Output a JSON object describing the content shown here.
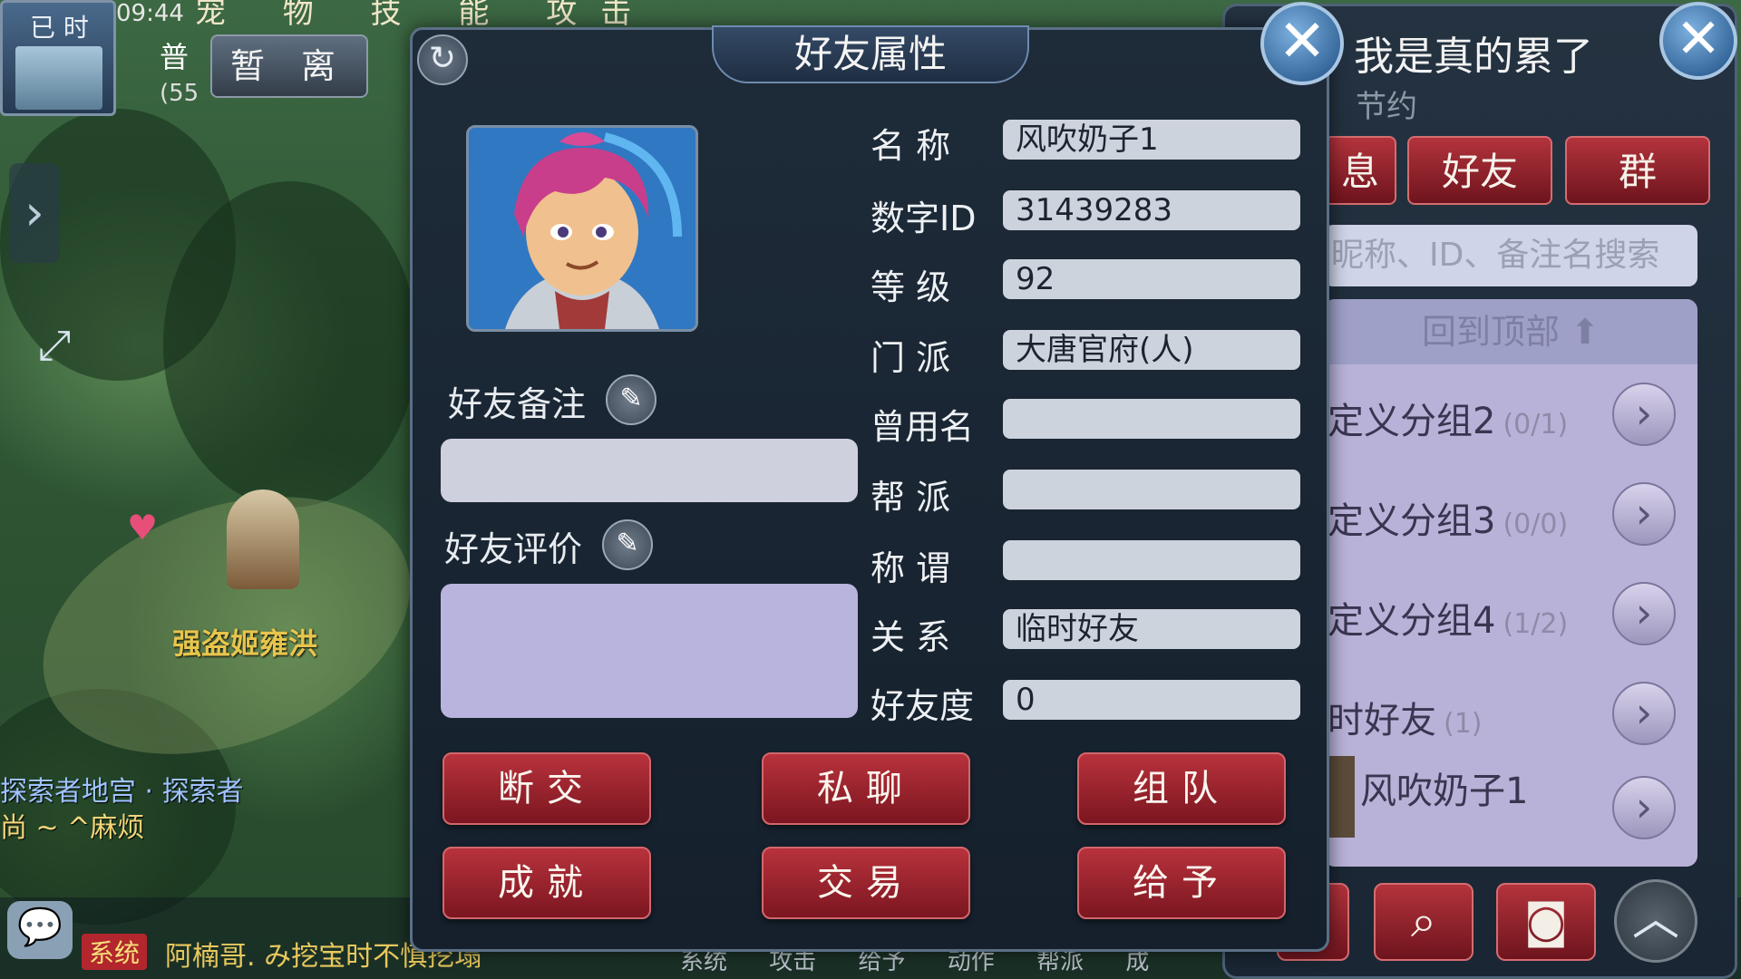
{
  "hud": {
    "status_label": "已 时",
    "time": "09:44",
    "top_menu": "宠 物 技 能 攻击",
    "leave_button": "暂 离",
    "pu_label": "普",
    "p55_label": "(55"
  },
  "scene": {
    "npc_name": "强盗姬雍洪",
    "chat_line1": "探索者地宫 · 探索者",
    "chat_line2": "尚 ~ ^麻烦",
    "system_badge": "系统",
    "system_message": "阿楠哥. み挖宝时不慎挖塌",
    "bottom_tabs": "系统 攻击 给予 动作 帮派 成"
  },
  "dialog": {
    "title": "好友属性",
    "remark_label": "好友备注",
    "review_label": "好友评价",
    "remark_value": "",
    "review_value": "",
    "fields": [
      {
        "label": "名 称",
        "value": "风吹奶子1"
      },
      {
        "label": "数字ID",
        "value": "31439283"
      },
      {
        "label": "等 级",
        "value": "92"
      },
      {
        "label": "门 派",
        "value": "大唐官府(人)"
      },
      {
        "label": "曾用名",
        "value": ""
      },
      {
        "label": "帮 派",
        "value": ""
      },
      {
        "label": "称 谓",
        "value": ""
      },
      {
        "label": "关 系",
        "value": "临时好友"
      },
      {
        "label": "好友度",
        "value": "0"
      }
    ],
    "buttons": {
      "break": "断交",
      "private_chat": "私聊",
      "team": "组队",
      "achievement": "成就",
      "trade": "交易",
      "give": "给予"
    }
  },
  "friend_panel": {
    "title": "我是真的累了",
    "subtitle": "节约",
    "tabs": [
      "息",
      "好友",
      "群"
    ],
    "search_placeholder": "昵称、ID、备注名搜索",
    "back_to_top": "回到顶部",
    "groups": [
      {
        "name": "定义分组2",
        "count": "(0/1)"
      },
      {
        "name": "定义分组3",
        "count": "(0/0)"
      },
      {
        "name": "定义分组4",
        "count": "(1/2)"
      },
      {
        "name": "时好友",
        "count": "(1)"
      },
      {
        "name": "风吹奶子1",
        "count": ""
      }
    ]
  },
  "icons": {
    "close": "close-icon",
    "refresh": "refresh-icon",
    "pencil": "pencil-icon",
    "search": "search-icon",
    "arrow_right": "chevron-right-icon",
    "up": "chevron-up-icon"
  }
}
